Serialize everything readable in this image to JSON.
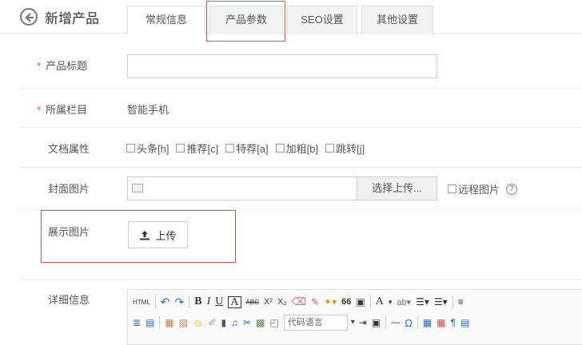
{
  "header": {
    "title": "新增产品"
  },
  "tabs": [
    {
      "label": "常规信息",
      "active": true
    },
    {
      "label": "产品参数",
      "active": false
    },
    {
      "label": "SEO设置",
      "active": false
    },
    {
      "label": "其他设置",
      "active": false
    }
  ],
  "form": {
    "required_mark": "*",
    "title_label": "产品标题",
    "title_value": "",
    "category_label": "所属栏目",
    "category_value": "智能手机",
    "attr_label": "文档属性",
    "attrs": [
      "头条[h]",
      "推荐[c]",
      "特荐[a]",
      "加粗[b]",
      "跳转[j]"
    ],
    "cover_label": "封面图片",
    "cover_button": "选择上传...",
    "remote_image": "远程图片",
    "help": "?",
    "display_label": "展示图片",
    "upload_button": "上传",
    "detail_label": "详细信息"
  },
  "editor": {
    "html_btn": "HTML",
    "bold": "B",
    "italic": "I",
    "underline": "U",
    "strike": "ABC",
    "superscript": "X²",
    "subscript": "X₂",
    "quote": "66",
    "font_color": "A",
    "code_lang_placeholder": "代码语言",
    "omega": "Ω",
    "hr": "—"
  },
  "colors": {
    "highlight": "#d9534f",
    "required": "#e8631d",
    "border": "#cccccc"
  }
}
